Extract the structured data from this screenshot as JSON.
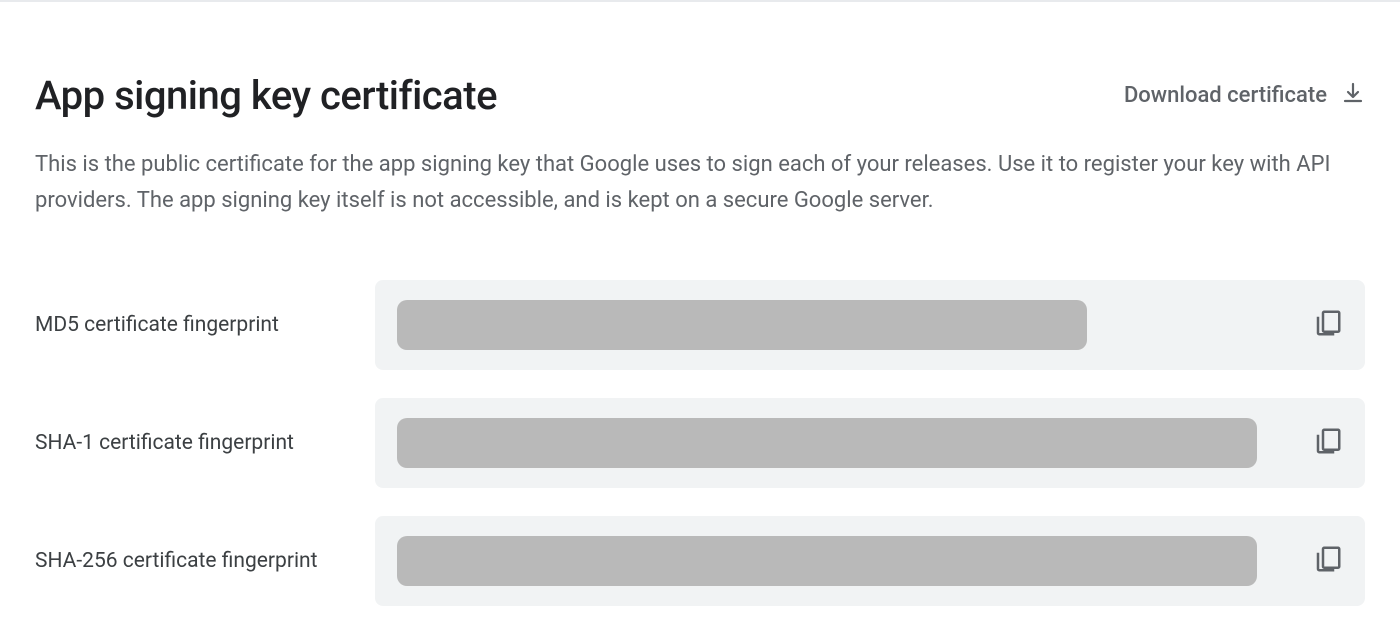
{
  "header": {
    "title": "App signing key certificate",
    "download_label": "Download certificate"
  },
  "description": "This is the public certificate for the app signing key that Google uses to sign each of your releases. Use it to register your key with API providers. The app signing key itself is not accessible, and is kept on a secure Google server.",
  "fingerprints": {
    "md5": {
      "label": "MD5 certificate fingerprint",
      "value": ""
    },
    "sha1": {
      "label": "SHA-1 certificate fingerprint",
      "value": ""
    },
    "sha256": {
      "label": "SHA-256 certificate fingerprint",
      "value": ""
    }
  }
}
